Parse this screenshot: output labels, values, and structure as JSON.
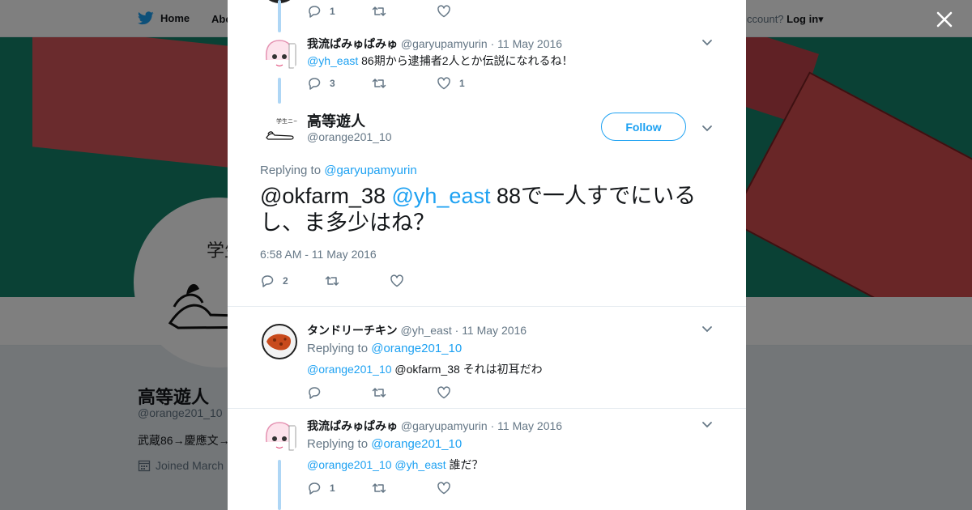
{
  "background": {
    "nav_home": "Home",
    "nav_about": "Abo",
    "nav_have_account": "ccount?",
    "nav_login": "Log in",
    "profile_name": "高等遊人",
    "profile_handle": "@orange201_10",
    "profile_bio": "武蔵86→慶應文→",
    "profile_joined": "Joined March"
  },
  "thread": [
    {
      "replies": "1",
      "retweets": "",
      "likes": ""
    },
    {
      "name": "我流ぱみゅぱみゅ",
      "handle": "@garyupamyurin",
      "sep": "·",
      "date": "11 May 2016",
      "mention": "@yh_east",
      "text": " 86期から逮捕者2人とか伝説になれるね！",
      "replies": "3",
      "retweets": "",
      "likes": "1"
    }
  ],
  "main_tweet": {
    "name": "高等遊人",
    "handle": "@orange201_10",
    "follow_label": "Follow",
    "replying_label": "Replying to ",
    "replying_to": "@garyupamyurin",
    "text_user": "@okfarm_38 ",
    "text_mention": "@yh_east",
    "text_body": " 88で一人すでにいるし、ま多少はね？",
    "timestamp": "6:58 AM - 11 May 2016",
    "replies": "2",
    "retweets": "",
    "likes": ""
  },
  "replies": [
    {
      "name": "タンドリーチキン",
      "handle": "@yh_east",
      "sep": "·",
      "date": "11 May 2016",
      "replying_label": "Replying to ",
      "replying_to": "@orange201_10",
      "mention1": "@orange201_10",
      "text": " @okfarm_38 それは初耳だわ",
      "replies": "",
      "retweets": "",
      "likes": ""
    },
    {
      "name": "我流ぱみゅぱみゅ",
      "handle": "@garyupamyurin",
      "sep": "·",
      "date": "11 May 2016",
      "replying_label": "Replying to ",
      "replying_to": "@orange201_10",
      "mention1": "@orange201_10",
      "mention2": "@yh_east",
      "text": " 誰だ？",
      "replies": "1",
      "retweets": "",
      "likes": ""
    }
  ],
  "colors": {
    "link": "#1da1f2",
    "muted": "#657786",
    "thread_line": "#aed6f5",
    "banner_green": "#15836a",
    "banner_red": "#d5575a"
  },
  "icons": [
    "twitter-bird-icon",
    "close-icon",
    "reply-icon",
    "retweet-icon",
    "like-icon",
    "chevron-down-icon",
    "calendar-icon"
  ]
}
